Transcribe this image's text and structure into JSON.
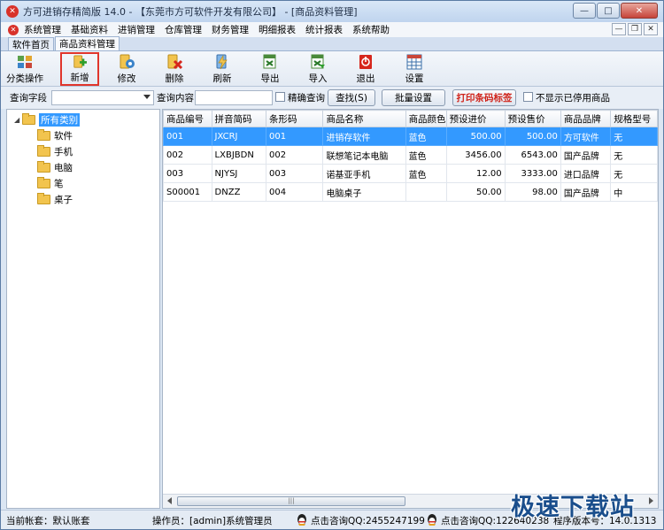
{
  "window": {
    "title": "方可进销存精简版 14.0 - 【东莞市方可软件开发有限公司】 - [商品资料管理]",
    "min_symbol": "—",
    "max_symbol": "□",
    "close_symbol": "✕"
  },
  "menubar": {
    "items": [
      "系统管理",
      "基础资料",
      "进销管理",
      "仓库管理",
      "财务管理",
      "明细报表",
      "统计报表",
      "系统帮助"
    ],
    "mdi_min": "—",
    "mdi_restore": "❐",
    "mdi_close": "✕"
  },
  "tabs": [
    "软件首页",
    "商品资料管理"
  ],
  "toolbar": {
    "buttons": [
      {
        "label": "分类操作",
        "icon": "category-icon"
      },
      {
        "label": "新增",
        "icon": "add-icon"
      },
      {
        "label": "修改",
        "icon": "edit-icon"
      },
      {
        "label": "删除",
        "icon": "delete-icon"
      },
      {
        "label": "刷新",
        "icon": "refresh-icon"
      },
      {
        "label": "导出",
        "icon": "export-icon"
      },
      {
        "label": "导入",
        "icon": "import-icon"
      },
      {
        "label": "退出",
        "icon": "exit-icon"
      },
      {
        "label": "设置",
        "icon": "settings-icon"
      }
    ]
  },
  "search": {
    "field_label": "查询字段",
    "field_value": "",
    "content_label": "查询内容",
    "content_value": "",
    "exact_label": "精确查询",
    "find_button": "查找(S)",
    "batch_button": "批量设置",
    "print_button": "打印条码标签",
    "hide_disabled_label": "不显示已停用商品"
  },
  "tree": {
    "root": "所有类别",
    "children": [
      "软件",
      "手机",
      "电脑",
      "笔",
      "桌子"
    ]
  },
  "grid": {
    "columns": [
      "商品编号",
      "拼音简码",
      "条形码",
      "商品名称",
      "商品颜色",
      "预设进价",
      "预设售价",
      "商品品牌",
      "规格型号"
    ],
    "rows": [
      [
        "001",
        "JXCRJ",
        "001",
        "进销存软件",
        "蓝色",
        "500.00",
        "500.00",
        "方可软件",
        "无"
      ],
      [
        "002",
        "LXBJBDN",
        "002",
        "联想笔记本电脑",
        "蓝色",
        "3456.00",
        "6543.00",
        "国产品牌",
        "无"
      ],
      [
        "003",
        "NJYSJ",
        "003",
        "诺基亚手机",
        "蓝色",
        "12.00",
        "3333.00",
        "进口品牌",
        "无"
      ],
      [
        "S00001",
        "DNZZ",
        "004",
        "电脑桌子",
        "",
        "50.00",
        "98.00",
        "国产品牌",
        "中"
      ]
    ],
    "selected_row": 0,
    "scroll_grip": "|||"
  },
  "status": {
    "account": "当前帐套：默认账套",
    "operator": "操作员：[admin]系统管理员",
    "qq1": "点击咨询QQ:2455247199",
    "qq2": "点击咨询QQ:122640238",
    "version": "程序版本号：14.0.1313"
  },
  "watermark": "极速下载站",
  "colors": {
    "selection": "#3399ff",
    "highlight_border": "#e0352b",
    "print_button_text": "#d0241b"
  }
}
